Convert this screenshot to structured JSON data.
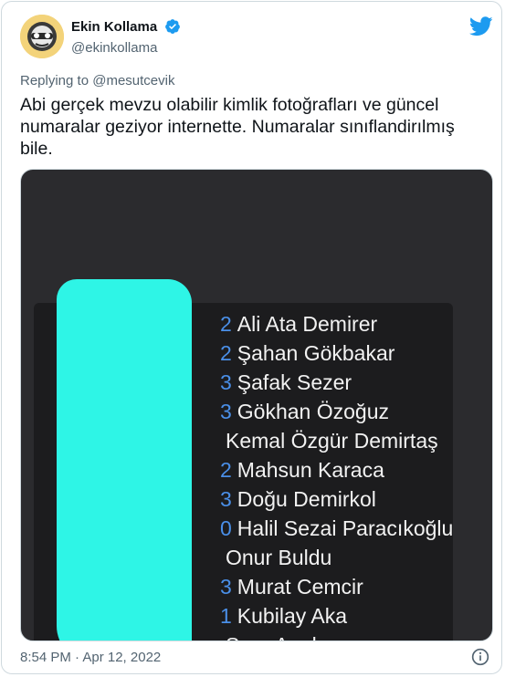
{
  "author": {
    "name": "Ekin Kollama",
    "handle": "@ekinkollama"
  },
  "reply": {
    "prefix": "Replying to",
    "mention": "@mesutcevik"
  },
  "tweet_text": "Abi gerçek mevzu olabilir kimlik fotoğrafları ve güncel numaralar geziyor internette. Numaralar sınıflandirılmış bile.",
  "contacts": [
    {
      "digit": "2",
      "name": "Ali Ata Demirer"
    },
    {
      "digit": "2",
      "name": "Şahan Gökbakar"
    },
    {
      "digit": "3",
      "name": "Şafak Sezer"
    },
    {
      "digit": "3",
      "name": "Gökhan Özoğuz"
    },
    {
      "digit": "",
      "name": "Kemal Özgür Demirtaş"
    },
    {
      "digit": "2",
      "name": "Mahsun Karaca"
    },
    {
      "digit": "3",
      "name": "Doğu Demirkol"
    },
    {
      "digit": "0",
      "name": "Halil Sezai Paracıkoğlu"
    },
    {
      "digit": "",
      "name": "Onur Buldu"
    },
    {
      "digit": "3",
      "name": "Murat Cemcir"
    },
    {
      "digit": "1",
      "name": "Kubilay Aka"
    },
    {
      "digit": "",
      "name": "Serp Apak"
    }
  ],
  "timestamp": "8:54 PM · Apr 12, 2022",
  "colors": {
    "cover": "#2ef5e6",
    "twitter_blue": "#1d9bf0"
  }
}
